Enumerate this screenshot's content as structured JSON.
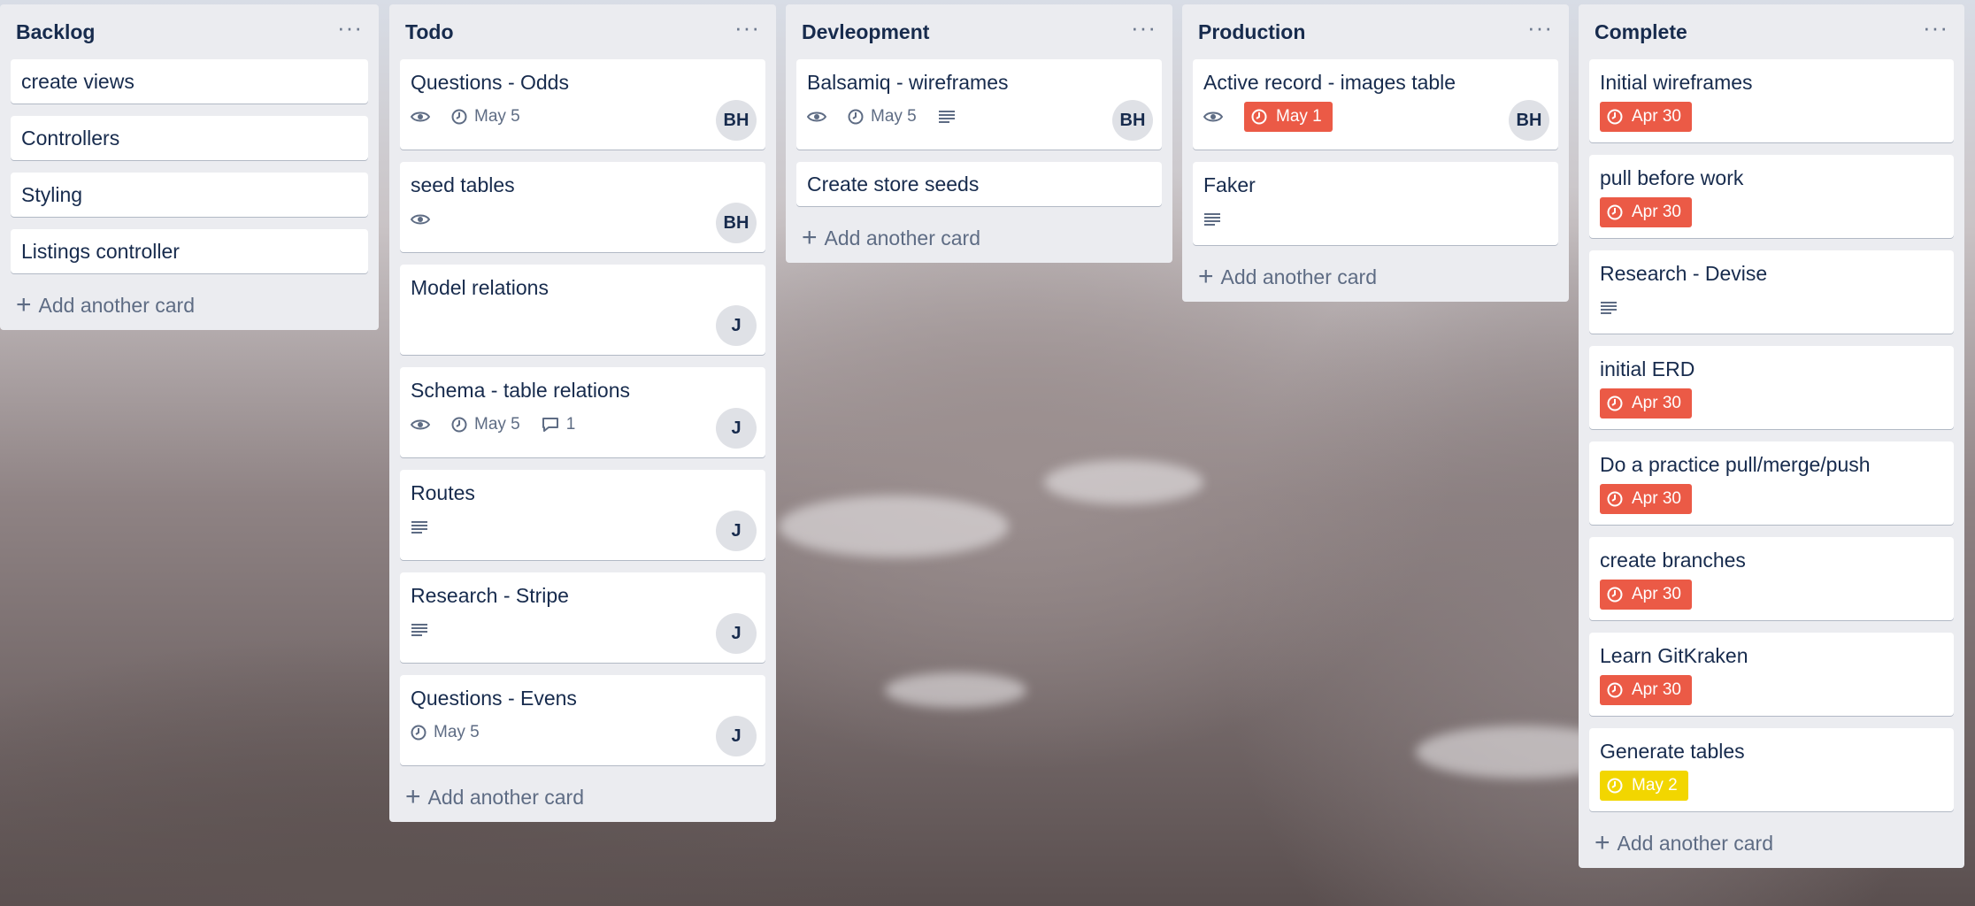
{
  "lists": [
    {
      "title": "Backlog",
      "menu": "···",
      "add_label": "Add another card",
      "cards": [
        {
          "title": "create views"
        },
        {
          "title": "Controllers"
        },
        {
          "title": "Styling"
        },
        {
          "title": "Listings controller"
        }
      ]
    },
    {
      "title": "Todo",
      "menu": "···",
      "add_label": "Add another card",
      "cards": [
        {
          "title": "Questions - Odds",
          "watch": true,
          "date": "May 5",
          "avatar": "BH"
        },
        {
          "title": "seed tables",
          "watch": true,
          "avatar": "BH"
        },
        {
          "title": "Model relations",
          "avatar": "J"
        },
        {
          "title": "Schema - table relations",
          "watch": true,
          "date": "May 5",
          "comments": "1",
          "avatar": "J"
        },
        {
          "title": "Routes",
          "description": true,
          "avatar": "J"
        },
        {
          "title": "Research - Stripe",
          "description": true,
          "avatar": "J"
        },
        {
          "title": "Questions - Evens",
          "date": "May 5",
          "avatar": "J"
        }
      ]
    },
    {
      "title": "Devleopment",
      "menu": "···",
      "add_label": "Add another card",
      "cards": [
        {
          "title": "Balsamiq - wireframes",
          "watch": true,
          "date": "May 5",
          "description": true,
          "avatar": "BH"
        },
        {
          "title": "Create store seeds"
        }
      ]
    },
    {
      "title": "Production",
      "menu": "···",
      "add_label": "Add another card",
      "cards": [
        {
          "title": "Active record - images table",
          "watch": true,
          "due": "May 1",
          "due_color": "#eb5a46",
          "avatar": "BH"
        },
        {
          "title": "Faker",
          "description": true
        }
      ]
    },
    {
      "title": "Complete",
      "menu": "···",
      "add_label": "Add another card",
      "cards": [
        {
          "title": "Initial wireframes",
          "due": "Apr 30",
          "due_color": "#eb5a46"
        },
        {
          "title": "pull before work",
          "due": "Apr 30",
          "due_color": "#eb5a46"
        },
        {
          "title": "Research - Devise",
          "description": true
        },
        {
          "title": "initial ERD",
          "due": "Apr 30",
          "due_color": "#eb5a46"
        },
        {
          "title": "Do a practice pull/merge/push",
          "due": "Apr 30",
          "due_color": "#eb5a46"
        },
        {
          "title": "create branches",
          "due": "Apr 30",
          "due_color": "#eb5a46"
        },
        {
          "title": "Learn GitKraken",
          "due": "Apr 30",
          "due_color": "#eb5a46"
        },
        {
          "title": "Generate tables",
          "due": "May 2",
          "due_color": "#f2d600"
        }
      ]
    }
  ]
}
